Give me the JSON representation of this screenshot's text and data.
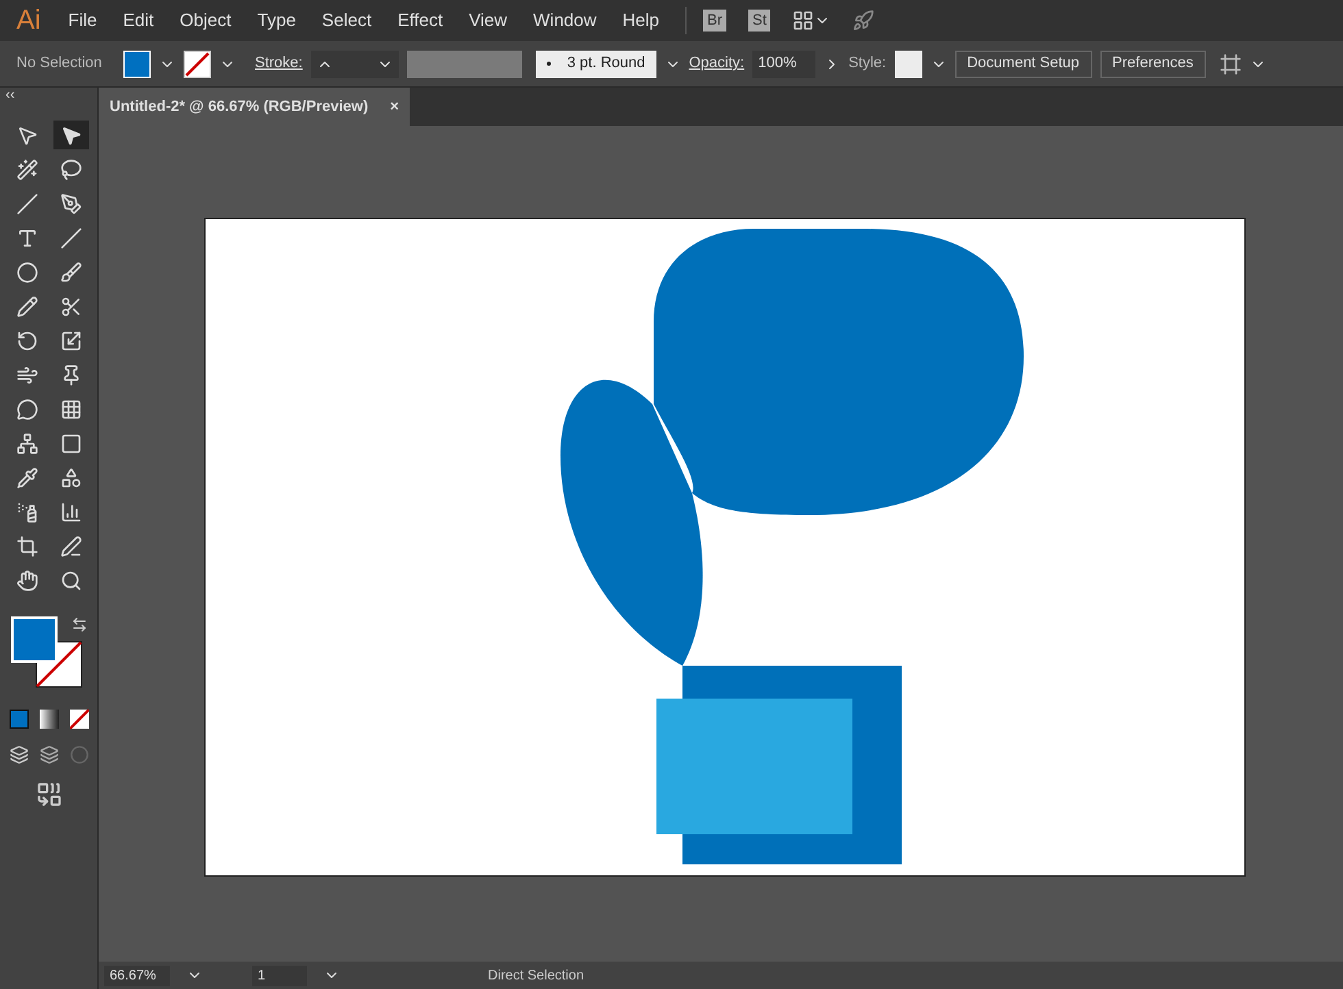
{
  "app_logo": "Ai",
  "menu": [
    "File",
    "Edit",
    "Object",
    "Type",
    "Select",
    "Effect",
    "View",
    "Window",
    "Help"
  ],
  "app_badges": [
    "Br",
    "St"
  ],
  "control_bar": {
    "selection": "No Selection",
    "stroke_label": "Stroke:",
    "brush": "3 pt. Round",
    "opacity_label": "Opacity:",
    "opacity": "100%",
    "style_label": "Style:",
    "buttons": [
      "Document Setup",
      "Preferences"
    ]
  },
  "panel_collapse": "‹‹",
  "document_tab": {
    "title": "Untitled-2* @ 66.67% (RGB/Preview)",
    "close": "×"
  },
  "tools": [
    {
      "selected": false
    },
    {
      "selected": true
    },
    {
      "selected": false
    },
    {
      "selected": false
    },
    {
      "selected": false
    },
    {
      "selected": false
    },
    {
      "selected": false
    },
    {
      "selected": false
    },
    {
      "selected": false
    },
    {
      "selected": false
    },
    {
      "selected": false
    },
    {
      "selected": false
    },
    {
      "selected": false
    },
    {
      "selected": false
    },
    {
      "selected": false
    },
    {
      "selected": false
    },
    {
      "selected": false
    },
    {
      "selected": false
    },
    {
      "selected": false
    },
    {
      "selected": false
    },
    {
      "selected": false
    },
    {
      "selected": false
    },
    {
      "selected": false
    },
    {
      "selected": false
    },
    {
      "selected": false
    },
    {
      "selected": false
    },
    {
      "selected": false
    },
    {
      "selected": false
    }
  ],
  "status_bar": {
    "zoom": "66.67%",
    "artboard": "1",
    "tool": "Direct Selection"
  }
}
